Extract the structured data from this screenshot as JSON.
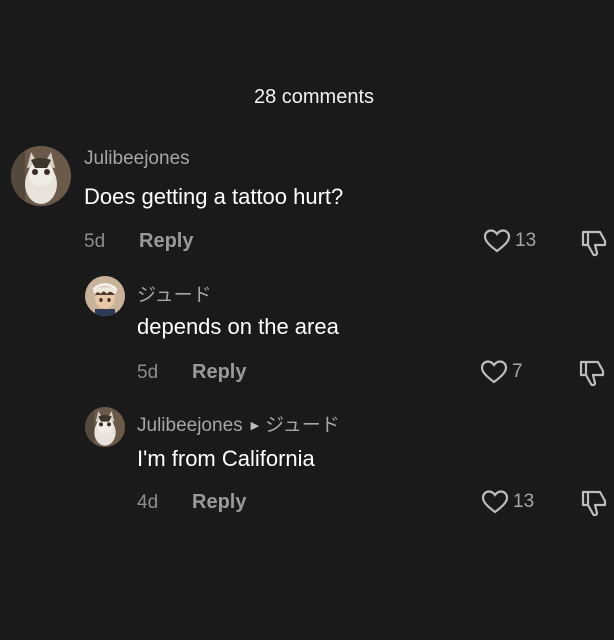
{
  "header": {
    "title": "28 comments"
  },
  "comments": [
    {
      "username": "Julibeejones",
      "text": "Does getting a tattoo hurt?",
      "time": "5d",
      "reply_label": "Reply",
      "likes": "13",
      "avatar": "cat-avatar"
    },
    {
      "username": "ジュード",
      "text": "depends on the area",
      "time": "5d",
      "reply_label": "Reply",
      "likes": "7",
      "avatar": "anime-character-avatar"
    },
    {
      "username": "Julibeejones",
      "reply_to": "ジュード",
      "text": "I'm from California",
      "time": "4d",
      "reply_label": "Reply",
      "likes": "13",
      "avatar": "cat-avatar"
    }
  ]
}
